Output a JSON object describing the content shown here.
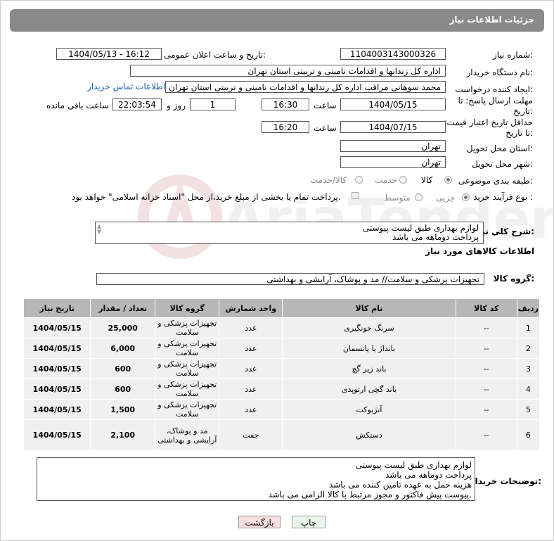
{
  "header": {
    "title": "جزئیات اطلاعات نیاز"
  },
  "form": {
    "need_number_label": "شماره نیاز:",
    "need_number": "1104003143000326",
    "announce_label": "تاریخ و ساعت اعلان عمومی:",
    "announce_value": "1404/05/13 - 16:12",
    "buyer_org_label": "نام دستگاه خریدار:",
    "buyer_org": "اداره کل زندانها و اقدامات تامینی و تربیتی استان تهران",
    "creator_label": "ایجاد کننده درخواست:",
    "creator": "محمد سوهانی مراقب  اداره کل زندانها و اقدامات تامینی و تربیتی استان تهران",
    "contact_link": "اطلاعات تماس خریدار",
    "reply_deadline_label": "مهلت ارسال پاسخ: تا تاریخ:",
    "reply_date": "1404/05/15",
    "time_label": "ساعت",
    "reply_time": "16:30",
    "days": "1",
    "days_label": "روز و",
    "remaining": "22:03:54",
    "remaining_label": "ساعت باقی مانده",
    "validity_label": "حداقل تاریخ اعتبار قیمت: تا تاریخ:",
    "validity_date": "1404/07/15",
    "validity_time": "16:20",
    "province_label": "استان محل تحویل:",
    "province": "تهران",
    "city_label": "شهر محل تحویل:",
    "city": "تهران",
    "category_label": "طبقه بندی موضوعی:",
    "category_options": [
      "کالا",
      "خدمت",
      "کالا/خدمت"
    ],
    "purchase_type_label": "نوع فرآیند خرید :",
    "purchase_options": [
      "جزیی",
      "متوسط"
    ],
    "payment_note": "پرداخت تمام یا بخشی از مبلغ خرید،از محل \"اسناد خزانه اسلامی\" خواهد بود."
  },
  "description": {
    "label": "شرح کلی نیاز:",
    "lines": [
      "لوازم بهداری طبق لیست پیوستی",
      "پرداخت دوماهه می باشد"
    ]
  },
  "goods_info": {
    "title": "اطلاعات کالاهای مورد نیاز",
    "group_label": "گروه کالا:",
    "group_value": "تجهیزات پزشکی و سلامت// مد و پوشاک، آرایشی و بهداشتی"
  },
  "table": {
    "headers": [
      "ردیف",
      "کد کالا",
      "نام کالا",
      "واحد شمارش",
      "گروه کالا",
      "تعداد / مقدار",
      "تاریخ نیاز"
    ],
    "rows": [
      {
        "idx": "1",
        "code": "--",
        "name": "سرنگ خونگیری",
        "unit": "عدد",
        "group": "تجهیزات پزشکی و سلامت",
        "qty": "25,000",
        "date": "1404/05/15"
      },
      {
        "idx": "2",
        "code": "--",
        "name": "بانداژ یا پانسمان",
        "unit": "عدد",
        "group": "تجهیزات پزشکی و سلامت",
        "qty": "6,000",
        "date": "1404/05/15"
      },
      {
        "idx": "3",
        "code": "--",
        "name": "باند زیر گچ",
        "unit": "عدد",
        "group": "تجهیزات پزشکی و سلامت",
        "qty": "600",
        "date": "1404/05/15"
      },
      {
        "idx": "4",
        "code": "--",
        "name": "باند گچی ارتوپدی",
        "unit": "عدد",
        "group": "تجهیزات پزشکی و سلامت",
        "qty": "600",
        "date": "1404/05/15"
      },
      {
        "idx": "5",
        "code": "--",
        "name": "آنژیوکت",
        "unit": "عدد",
        "group": "تجهیزات پزشکی و سلامت",
        "qty": "1,500",
        "date": "1404/05/15"
      },
      {
        "idx": "6",
        "code": "--",
        "name": "دستکش",
        "unit": "جفت",
        "group": "مد و پوشاک، آرایشی و بهداشتی",
        "qty": "2,100",
        "date": "1404/05/15"
      }
    ]
  },
  "buyer_notes": {
    "label": "توضیحات خریدار:",
    "lines": [
      "لوازم بهداری طبق لیست پیوستی",
      "پرداخت دوماهه می باشد",
      "هزینه حمل به عهده تامین کننده می باشد",
      "پیوست پیش فاکتور و مجوز مرتبط با کالا الزامی می باشد."
    ]
  },
  "buttons": {
    "print": "چاپ",
    "back": "بازگشت"
  },
  "watermark": "AriaTender.net",
  "colors": {
    "header_bg": "#8a8a8a",
    "table_header": "#b7b7b7",
    "back_btn": "#f8e0e0",
    "print_btn": "#eaf6ea",
    "link": "#1a5fb4"
  }
}
